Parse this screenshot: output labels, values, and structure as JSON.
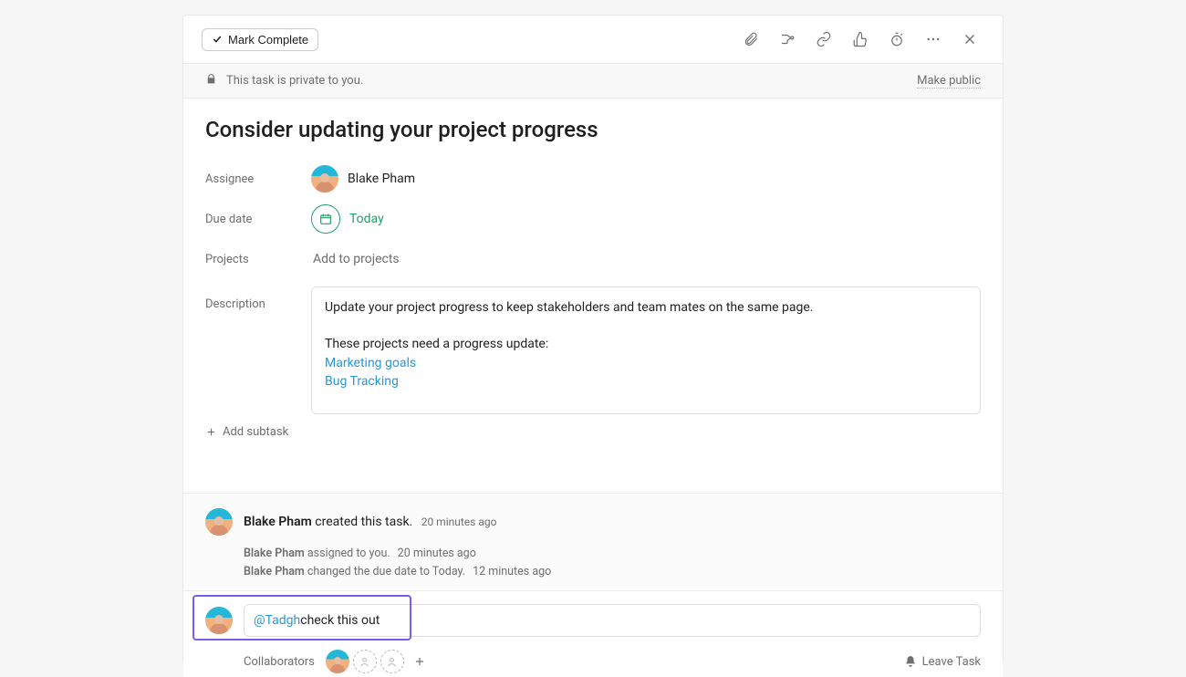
{
  "toolbar": {
    "mark_complete_label": "Mark Complete"
  },
  "privacy": {
    "message": "This task is private to you.",
    "make_public_label": "Make public"
  },
  "task": {
    "title": "Consider updating your project progress",
    "labels": {
      "assignee": "Assignee",
      "due_date": "Due date",
      "projects": "Projects",
      "description": "Description"
    },
    "assignee_name": "Blake Pham",
    "due_date_value": "Today",
    "projects_placeholder": "Add to projects",
    "description": {
      "line1": "Update your project progress to keep stakeholders and team mates on the same page.",
      "line2": "These projects need a progress update:",
      "links": [
        "Marketing goals",
        "Bug Tracking"
      ]
    },
    "add_subtask_label": "Add subtask"
  },
  "activity": {
    "heading_actor": "Blake Pham",
    "heading_action": " created this task.",
    "heading_ts": "20 minutes ago",
    "items": [
      {
        "actor": "Blake Pham",
        "text": " assigned to you.",
        "ts": "20 minutes ago"
      },
      {
        "actor": "Blake Pham",
        "text": " changed the due date to Today.",
        "ts": "12 minutes ago"
      }
    ]
  },
  "comment": {
    "mention": "@Tadgh",
    "rest": " check this out"
  },
  "footer": {
    "collaborators_label": "Collaborators",
    "leave_label": "Leave Task"
  }
}
